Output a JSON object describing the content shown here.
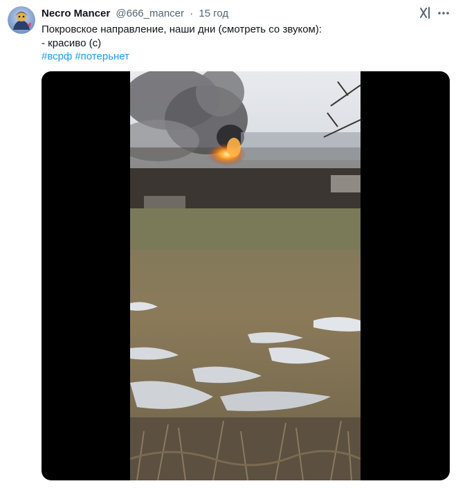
{
  "author": {
    "display_name": "Necro Mancer",
    "handle": "@666_mancer",
    "separator": "·",
    "time": "15 год"
  },
  "tweet": {
    "line1": "Покровское направление, наши дни (смотреть со звуком):",
    "line2": "- красиво (с)",
    "hashtags": [
      "#всрф",
      "#потерьнет"
    ]
  },
  "icons": {
    "avatar": "avatar-image",
    "grok": "grok-icon",
    "more": "more-icon"
  },
  "colors": {
    "link": "#1d9bf0",
    "secondary_text": "#536471",
    "primary_text": "#0f1419",
    "media_background": "#000000"
  }
}
